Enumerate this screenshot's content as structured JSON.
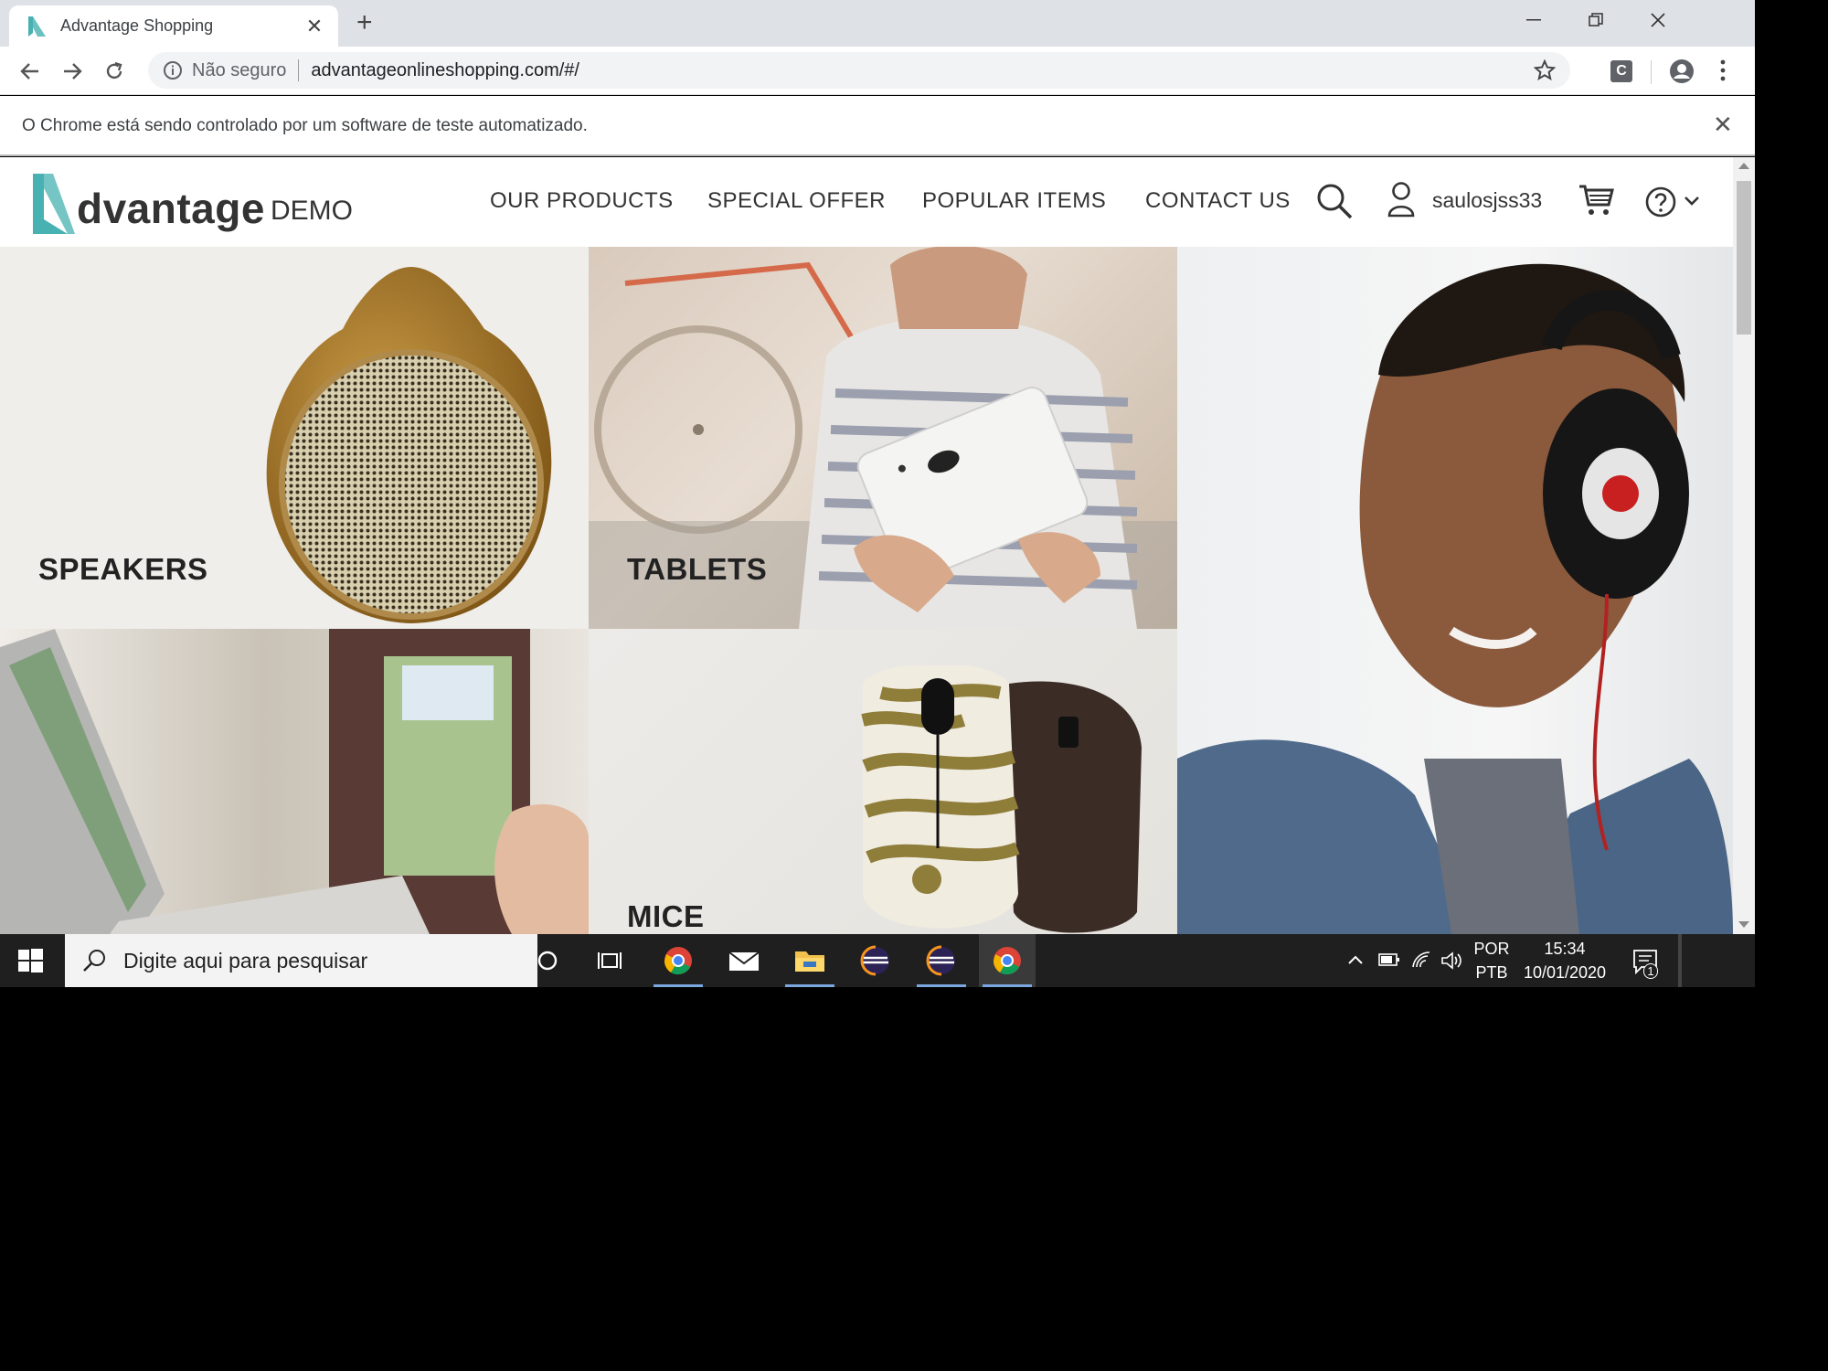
{
  "browser": {
    "tab_title": "Advantage Shopping",
    "security_label": "Não seguro",
    "url": "advantageonlineshopping.com/#/",
    "extension_letter": "C",
    "infobar_message": "O Chrome está sendo controlado por um software de teste automatizado."
  },
  "site": {
    "logo_word": "dvantage",
    "logo_suffix": "DEMO",
    "nav": {
      "our_products": "OUR PRODUCTS",
      "special_offer": "SPECIAL OFFER",
      "popular_items": "POPULAR ITEMS",
      "contact_us": "CONTACT US"
    },
    "username": "saulosjss33",
    "categories": {
      "speakers": "SPEAKERS",
      "tablets": "TABLETS",
      "mice": "MICE"
    },
    "colors": {
      "brand_teal": "#48b1b1",
      "text_dark": "#222222"
    }
  },
  "taskbar": {
    "search_placeholder": "Digite aqui para pesquisar",
    "lang_top": "POR",
    "lang_bottom": "PTB",
    "time": "15:34",
    "date": "10/01/2020",
    "notification_count": "1"
  }
}
